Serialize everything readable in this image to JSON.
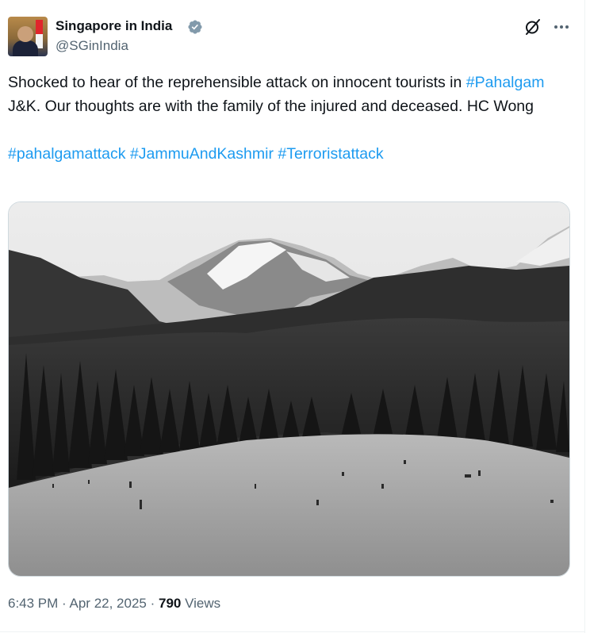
{
  "author": {
    "display_name": "Singapore in India",
    "handle": "@SGinIndia",
    "verified_icon": "verified-badge-icon",
    "badge_color": "#829aab"
  },
  "actions": {
    "grok_icon": "grok-icon",
    "more_icon": "more-options-icon"
  },
  "tweet": {
    "line1_prefix": "Shocked to hear of the reprehensible attack on innocent tourists in",
    "hashtag_pahalgam": "#Pahalgam",
    "line1_suffix": "J&K. Our thoughts are with the family of the injured and deceased. HC Wong",
    "hashtags": [
      "#pahalgamattack",
      "#JammuAndKashmir",
      "#Terroristattack"
    ],
    "link_color": "#1d9bf0"
  },
  "media": {
    "description_icon": "photo-mountain-meadow"
  },
  "meta": {
    "time": "6:43 PM",
    "separator": "·",
    "date": "Apr 22, 2025",
    "views_count": "790",
    "views_label": "Views"
  }
}
